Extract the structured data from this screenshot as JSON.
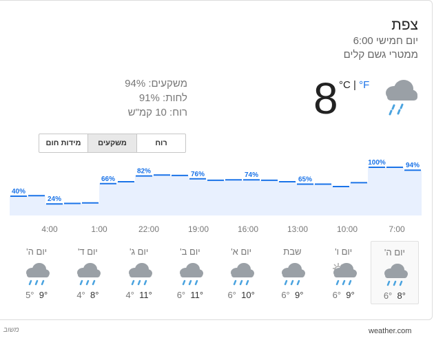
{
  "location": "צפת",
  "time": "יום חמישי 6:00",
  "condition": "ממטרי גשם קלים",
  "current_temp": "8",
  "unit_c": "°C",
  "unit_sep": " | ",
  "unit_f": "°F",
  "current_icon": "rain-cloud-icon",
  "details": {
    "precipitation": "משקעים: 94%",
    "humidity": "לחות: 91%",
    "wind": "רוח: 10 קמ\"ש"
  },
  "tabs": [
    "מידות חום",
    "משקעים",
    "רוח"
  ],
  "active_tab": "משקעים",
  "chart_data": {
    "type": "step-area",
    "metric": "precipitation",
    "unit": "%",
    "values_left_to_right": [
      40,
      41,
      24,
      25,
      26,
      66,
      70,
      82,
      84,
      83,
      76,
      73,
      74,
      74,
      73,
      70,
      65,
      65,
      60,
      68,
      100,
      100,
      94
    ],
    "data_labels": [
      "40%",
      "24%",
      "66%",
      "82%",
      "76%",
      "74%",
      "65%",
      "100%",
      "94%"
    ],
    "ylim": [
      0,
      100
    ],
    "hour_labels": [
      "4:00",
      "1:00",
      "22:00",
      "19:00",
      "16:00",
      "13:00",
      "10:00",
      "7:00"
    ]
  },
  "days": [
    {
      "name": "יום ה'",
      "hi": "8°",
      "lo": "6°",
      "icon": "rain-cloud-icon",
      "selected": true
    },
    {
      "name": "יום ו'",
      "hi": "9°",
      "lo": "6°",
      "icon": "sun-cloud-rain-icon",
      "selected": false
    },
    {
      "name": "שבת",
      "hi": "9°",
      "lo": "6°",
      "icon": "rain-cloud-icon",
      "selected": false
    },
    {
      "name": "יום א'",
      "hi": "10°",
      "lo": "6°",
      "icon": "rain-cloud-icon",
      "selected": false
    },
    {
      "name": "יום ב'",
      "hi": "11°",
      "lo": "6°",
      "icon": "rain-cloud-icon",
      "selected": false
    },
    {
      "name": "יום ג'",
      "hi": "11°",
      "lo": "4°",
      "icon": "rain-cloud-icon",
      "selected": false
    },
    {
      "name": "יום ד'",
      "hi": "8°",
      "lo": "4°",
      "icon": "rain-cloud-icon",
      "selected": false
    },
    {
      "name": "יום ה'",
      "hi": "9°",
      "lo": "5°",
      "icon": "rain-cloud-icon",
      "selected": false
    }
  ],
  "footer_feedback": "משוב",
  "footer_source": "weather.com",
  "colors": {
    "accent": "#1a73e8",
    "fill": "#e8f0fe",
    "icon_cloud": "#9aa0a6",
    "rain": "#4aa3df"
  }
}
